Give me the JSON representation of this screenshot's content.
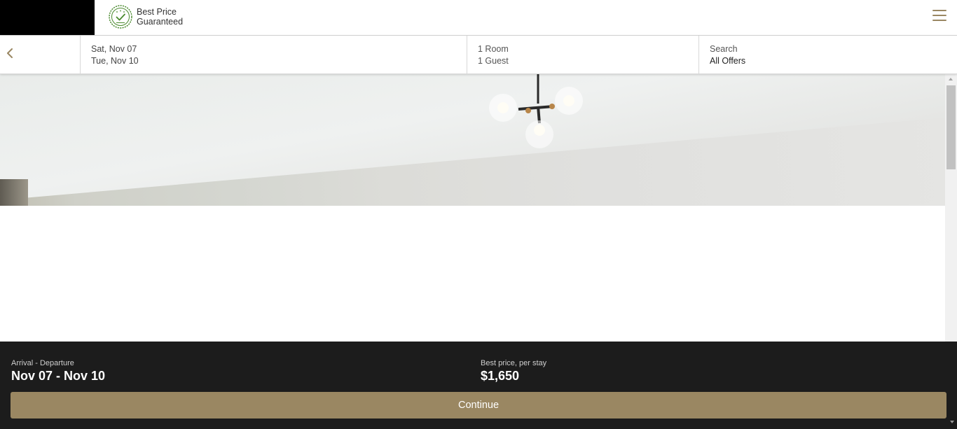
{
  "header": {
    "badge_line1": "Best Price",
    "badge_line2": "Guaranteed",
    "menu_icon": "hamburger-menu-icon",
    "accent_color": "#9a8762",
    "badge_color": "#4a8a2e"
  },
  "search_bar": {
    "back_icon": "chevron-left-icon",
    "arrival": "Sat, Nov 07",
    "departure": "Tue, Nov 10",
    "rooms": "1 Room",
    "guests": "1 Guest",
    "search_label": "Search",
    "offers": "All Offers"
  },
  "footer": {
    "dates_label": "Arrival - Departure",
    "dates_value": "Nov 07 - Nov 10",
    "price_label": "Best price, per stay",
    "price_value": "$1,650",
    "continue_label": "Continue"
  }
}
